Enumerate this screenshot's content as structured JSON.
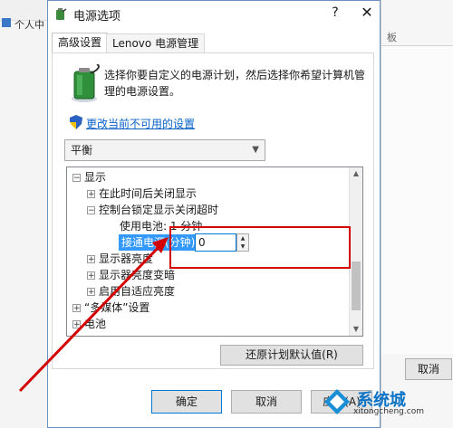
{
  "background": {
    "left_label": "个人中",
    "right_top": "板",
    "right_cancel": "取消"
  },
  "dialog": {
    "title": "电源选项",
    "help": "?",
    "close": "✕",
    "tabs": [
      {
        "label": "高级设置",
        "active": true
      },
      {
        "label": "Lenovo 电源管理",
        "active": false
      }
    ],
    "description": "选择你要自定义的电源计划，然后选择你希望计算机管理的电源设置。",
    "change_link": "更改当前不可用的设置",
    "plan_selected": "平衡",
    "tree": [
      {
        "indent": 0,
        "toggle": "⊟",
        "label": "显示"
      },
      {
        "indent": 1,
        "toggle": "⊞",
        "label": "在此时间后关闭显示"
      },
      {
        "indent": 1,
        "toggle": "⊟",
        "label": "控制台锁定显示关闭超时"
      },
      {
        "indent": 2,
        "toggle": "",
        "label": "使用电池: 1 分钟"
      },
      {
        "indent": 1,
        "toggle": "⊞",
        "label": "显示器亮度"
      },
      {
        "indent": 1,
        "toggle": "⊞",
        "label": "显示器亮度变暗"
      },
      {
        "indent": 1,
        "toggle": "⊞",
        "label": "启用自适应亮度"
      },
      {
        "indent": 0,
        "toggle": "⊞",
        "label": "“多媒体”设置"
      },
      {
        "indent": 0,
        "toggle": "⊞",
        "label": "电池"
      }
    ],
    "edit_label": "接通电源(分钟):",
    "edit_value": "0",
    "restore_button": "还原计划默认值(R)",
    "ok_button": "确定",
    "cancel_button": "取消",
    "apply_button": "应用(A)"
  },
  "watermark": {
    "line1": "系统城",
    "line2": "xitongcheng.com"
  },
  "colors": {
    "link": "#0a62c9",
    "highlight": "#3399ff",
    "annotation": "#d40000"
  }
}
